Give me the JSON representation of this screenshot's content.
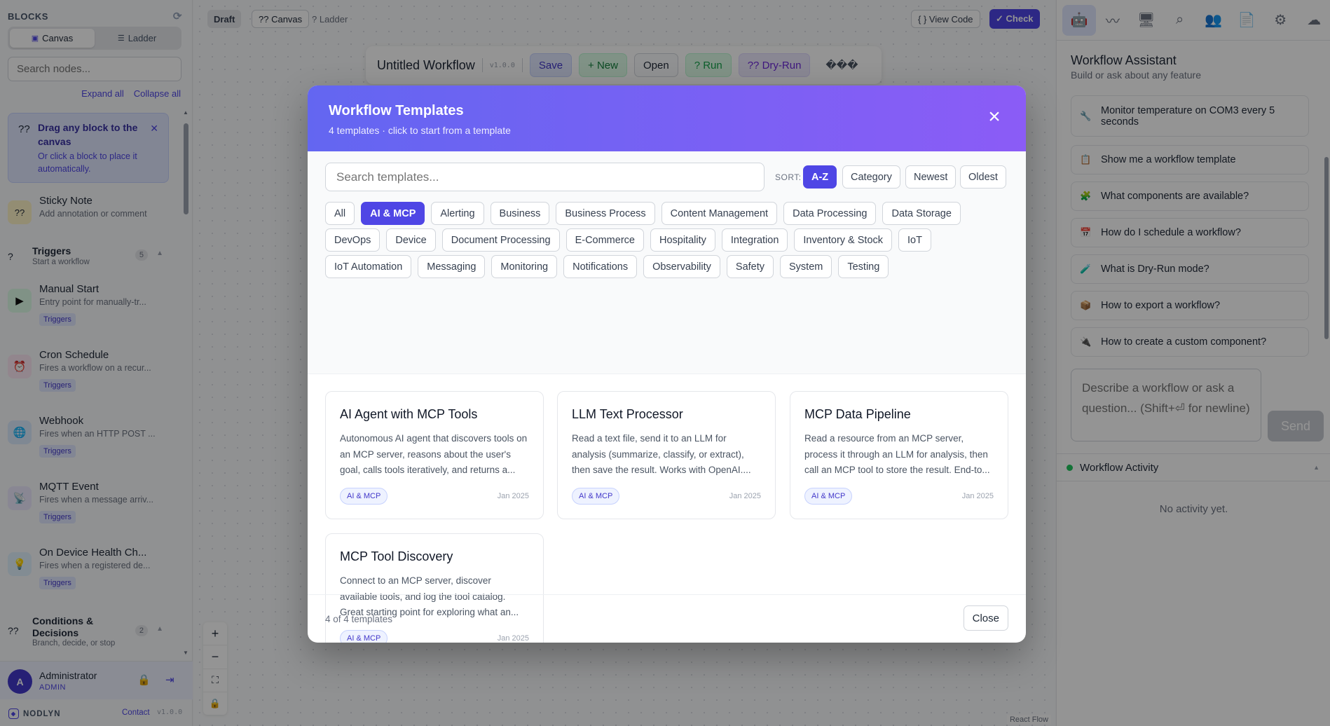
{
  "sidebar": {
    "header": "BLOCKS",
    "tabs": [
      {
        "label": "Canvas"
      },
      {
        "label": "Ladder"
      }
    ],
    "search_placeholder": "Search nodes...",
    "expand_all": "Expand all",
    "collapse_all": "Collapse all",
    "tip": {
      "title": "Drag any block to the canvas",
      "text": "Or click a block to place it automatically."
    },
    "sticky": {
      "name": "Sticky Note",
      "desc": "Add annotation or comment"
    },
    "groups": [
      {
        "name": "Triggers",
        "desc": "Start a workflow",
        "count": "5"
      },
      {
        "name": "Conditions & Decisions",
        "desc": "Branch, decide, or stop",
        "count": "2"
      }
    ],
    "nodes": [
      {
        "name": "Manual Start",
        "desc": "Entry point for manually-tr...",
        "tag": "Triggers"
      },
      {
        "name": "Cron Schedule",
        "desc": "Fires a workflow on a recur...",
        "tag": "Triggers"
      },
      {
        "name": "Webhook",
        "desc": "Fires when an HTTP POST ...",
        "tag": "Triggers"
      },
      {
        "name": "MQTT Event",
        "desc": "Fires when a message arriv...",
        "tag": "Triggers"
      },
      {
        "name": "On Device Health Ch...",
        "desc": "Fires when a registered de...",
        "tag": "Triggers"
      }
    ],
    "user": {
      "initial": "A",
      "name": "Administrator",
      "role": "ADMIN"
    },
    "footer": {
      "brand": "NODLYN",
      "contact": "Contact",
      "version": "v1.0.0"
    }
  },
  "canvas": {
    "status": "Draft",
    "mode_tabs": [
      "?? Canvas",
      "? Ladder"
    ],
    "view_code": "{ } View Code",
    "check": "✓ Check",
    "workflow_title": "Untitled Workflow",
    "workflow_version": "v1.0.0",
    "buttons": {
      "save": "Save",
      "new": "+ New",
      "open": "Open",
      "run": "? Run",
      "dry_run": "?? Dry-Run",
      "more": "���"
    },
    "react_flow": "React Flow"
  },
  "assistant": {
    "title": "Workflow Assistant",
    "subtitle": "Build or ask about any feature",
    "suggestions": [
      {
        "icon": "🔧",
        "text": "Monitor temperature on COM3 every 5 seconds"
      },
      {
        "icon": "📋",
        "text": "Show me a workflow template"
      },
      {
        "icon": "🧩",
        "text": "What components are available?"
      },
      {
        "icon": "📅",
        "text": "How do I schedule a workflow?"
      },
      {
        "icon": "🧪",
        "text": "What is Dry-Run mode?"
      },
      {
        "icon": "📦",
        "text": "How to export a workflow?"
      },
      {
        "icon": "🔌",
        "text": "How to create a custom component?"
      }
    ],
    "input_placeholder": "Describe a workflow or ask a question... (Shift+⏎ for newline)",
    "send": "Send",
    "activity_title": "Workflow Activity",
    "activity_empty": "No activity yet."
  },
  "modal": {
    "title": "Workflow Templates",
    "subtitle": "4 templates · click to start from a template",
    "search_placeholder": "Search templates...",
    "sort_label": "SORT:",
    "sort_options": [
      "A-Z",
      "Category",
      "Newest",
      "Oldest"
    ],
    "sort_active": "A-Z",
    "categories": [
      "All",
      "AI & MCP",
      "Alerting",
      "Business",
      "Business Process",
      "Content Management",
      "Data Processing",
      "Data Storage",
      "DevOps",
      "Device",
      "Document Processing",
      "E-Commerce",
      "Hospitality",
      "Integration",
      "Inventory & Stock",
      "IoT",
      "IoT Automation",
      "Messaging",
      "Monitoring",
      "Notifications",
      "Observability",
      "Safety",
      "System",
      "Testing"
    ],
    "category_active": "AI & MCP",
    "templates": [
      {
        "title": "AI Agent with MCP Tools",
        "desc": "Autonomous AI agent that discovers tools on an MCP server, reasons about the user's goal, calls tools iteratively, and returns a...",
        "badge": "AI & MCP",
        "date": "Jan 2025"
      },
      {
        "title": "LLM Text Processor",
        "desc": "Read a text file, send it to an LLM for analysis (summarize, classify, or extract), then save the result. Works with OpenAI....",
        "badge": "AI & MCP",
        "date": "Jan 2025"
      },
      {
        "title": "MCP Data Pipeline",
        "desc": "Read a resource from an MCP server, process it through an LLM for analysis, then call an MCP tool to store the result. End-to...",
        "badge": "AI & MCP",
        "date": "Jan 2025"
      },
      {
        "title": "MCP Tool Discovery",
        "desc": "Connect to an MCP server, discover available tools, and log the tool catalog. Great starting point for exploring what an...",
        "badge": "AI & MCP",
        "date": "Jan 2025"
      }
    ],
    "count_text": "4 of 4 templates",
    "close_label": "Close"
  }
}
